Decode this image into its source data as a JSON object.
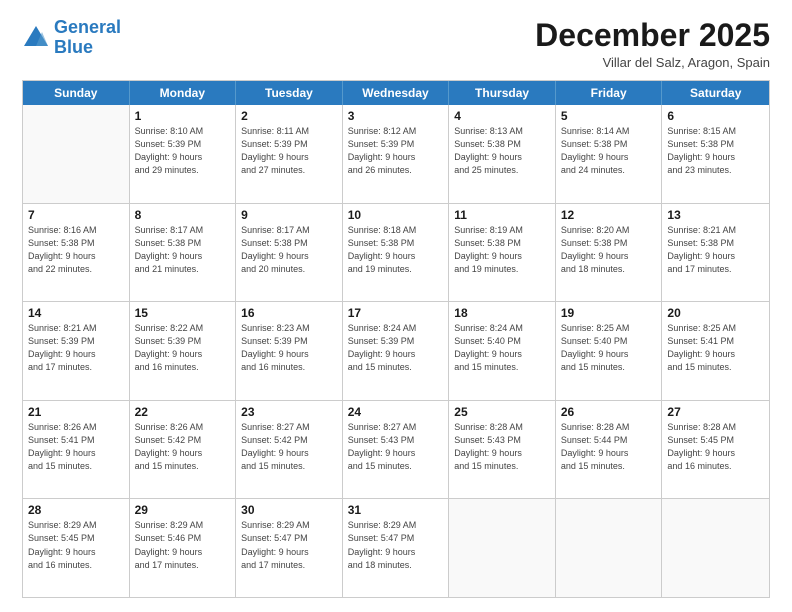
{
  "logo": {
    "line1": "General",
    "line2": "Blue"
  },
  "title": "December 2025",
  "location": "Villar del Salz, Aragon, Spain",
  "header_days": [
    "Sunday",
    "Monday",
    "Tuesday",
    "Wednesday",
    "Thursday",
    "Friday",
    "Saturday"
  ],
  "weeks": [
    [
      {
        "day": "",
        "info": "",
        "empty": true
      },
      {
        "day": "1",
        "info": "Sunrise: 8:10 AM\nSunset: 5:39 PM\nDaylight: 9 hours\nand 29 minutes."
      },
      {
        "day": "2",
        "info": "Sunrise: 8:11 AM\nSunset: 5:39 PM\nDaylight: 9 hours\nand 27 minutes."
      },
      {
        "day": "3",
        "info": "Sunrise: 8:12 AM\nSunset: 5:39 PM\nDaylight: 9 hours\nand 26 minutes."
      },
      {
        "day": "4",
        "info": "Sunrise: 8:13 AM\nSunset: 5:38 PM\nDaylight: 9 hours\nand 25 minutes."
      },
      {
        "day": "5",
        "info": "Sunrise: 8:14 AM\nSunset: 5:38 PM\nDaylight: 9 hours\nand 24 minutes."
      },
      {
        "day": "6",
        "info": "Sunrise: 8:15 AM\nSunset: 5:38 PM\nDaylight: 9 hours\nand 23 minutes."
      }
    ],
    [
      {
        "day": "7",
        "info": "Sunrise: 8:16 AM\nSunset: 5:38 PM\nDaylight: 9 hours\nand 22 minutes."
      },
      {
        "day": "8",
        "info": "Sunrise: 8:17 AM\nSunset: 5:38 PM\nDaylight: 9 hours\nand 21 minutes."
      },
      {
        "day": "9",
        "info": "Sunrise: 8:17 AM\nSunset: 5:38 PM\nDaylight: 9 hours\nand 20 minutes."
      },
      {
        "day": "10",
        "info": "Sunrise: 8:18 AM\nSunset: 5:38 PM\nDaylight: 9 hours\nand 19 minutes."
      },
      {
        "day": "11",
        "info": "Sunrise: 8:19 AM\nSunset: 5:38 PM\nDaylight: 9 hours\nand 19 minutes."
      },
      {
        "day": "12",
        "info": "Sunrise: 8:20 AM\nSunset: 5:38 PM\nDaylight: 9 hours\nand 18 minutes."
      },
      {
        "day": "13",
        "info": "Sunrise: 8:21 AM\nSunset: 5:38 PM\nDaylight: 9 hours\nand 17 minutes."
      }
    ],
    [
      {
        "day": "14",
        "info": "Sunrise: 8:21 AM\nSunset: 5:39 PM\nDaylight: 9 hours\nand 17 minutes."
      },
      {
        "day": "15",
        "info": "Sunrise: 8:22 AM\nSunset: 5:39 PM\nDaylight: 9 hours\nand 16 minutes."
      },
      {
        "day": "16",
        "info": "Sunrise: 8:23 AM\nSunset: 5:39 PM\nDaylight: 9 hours\nand 16 minutes."
      },
      {
        "day": "17",
        "info": "Sunrise: 8:24 AM\nSunset: 5:39 PM\nDaylight: 9 hours\nand 15 minutes."
      },
      {
        "day": "18",
        "info": "Sunrise: 8:24 AM\nSunset: 5:40 PM\nDaylight: 9 hours\nand 15 minutes."
      },
      {
        "day": "19",
        "info": "Sunrise: 8:25 AM\nSunset: 5:40 PM\nDaylight: 9 hours\nand 15 minutes."
      },
      {
        "day": "20",
        "info": "Sunrise: 8:25 AM\nSunset: 5:41 PM\nDaylight: 9 hours\nand 15 minutes."
      }
    ],
    [
      {
        "day": "21",
        "info": "Sunrise: 8:26 AM\nSunset: 5:41 PM\nDaylight: 9 hours\nand 15 minutes."
      },
      {
        "day": "22",
        "info": "Sunrise: 8:26 AM\nSunset: 5:42 PM\nDaylight: 9 hours\nand 15 minutes."
      },
      {
        "day": "23",
        "info": "Sunrise: 8:27 AM\nSunset: 5:42 PM\nDaylight: 9 hours\nand 15 minutes."
      },
      {
        "day": "24",
        "info": "Sunrise: 8:27 AM\nSunset: 5:43 PM\nDaylight: 9 hours\nand 15 minutes."
      },
      {
        "day": "25",
        "info": "Sunrise: 8:28 AM\nSunset: 5:43 PM\nDaylight: 9 hours\nand 15 minutes."
      },
      {
        "day": "26",
        "info": "Sunrise: 8:28 AM\nSunset: 5:44 PM\nDaylight: 9 hours\nand 15 minutes."
      },
      {
        "day": "27",
        "info": "Sunrise: 8:28 AM\nSunset: 5:45 PM\nDaylight: 9 hours\nand 16 minutes."
      }
    ],
    [
      {
        "day": "28",
        "info": "Sunrise: 8:29 AM\nSunset: 5:45 PM\nDaylight: 9 hours\nand 16 minutes."
      },
      {
        "day": "29",
        "info": "Sunrise: 8:29 AM\nSunset: 5:46 PM\nDaylight: 9 hours\nand 17 minutes."
      },
      {
        "day": "30",
        "info": "Sunrise: 8:29 AM\nSunset: 5:47 PM\nDaylight: 9 hours\nand 17 minutes."
      },
      {
        "day": "31",
        "info": "Sunrise: 8:29 AM\nSunset: 5:47 PM\nDaylight: 9 hours\nand 18 minutes."
      },
      {
        "day": "",
        "info": "",
        "empty": true
      },
      {
        "day": "",
        "info": "",
        "empty": true
      },
      {
        "day": "",
        "info": "",
        "empty": true
      }
    ]
  ]
}
